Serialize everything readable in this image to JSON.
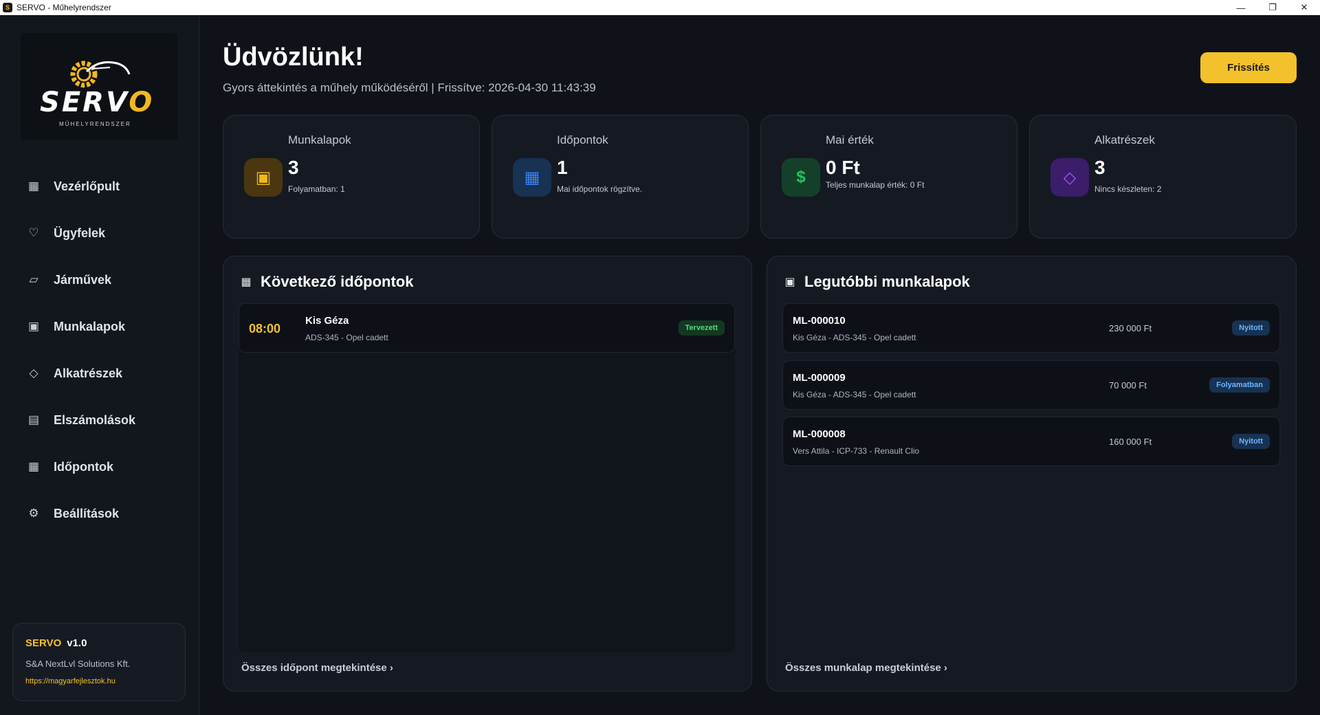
{
  "window": {
    "title": "SERVO - Műhelyrendszer",
    "controls": [
      "minimize-icon",
      "restore-icon",
      "close-icon"
    ]
  },
  "sidebar": {
    "logo": {
      "text": "SERVO",
      "subtitle": "MŰHELYRENDSZER"
    },
    "items": [
      {
        "label": "Vezérlőpult",
        "icon": "grid-icon"
      },
      {
        "label": "Ügyfelek",
        "icon": "heart-icon"
      },
      {
        "label": "Járművek",
        "icon": "car-icon"
      },
      {
        "label": "Munkalapok",
        "icon": "worksheet-icon"
      },
      {
        "label": "Alkatrészek",
        "icon": "diamond-icon"
      },
      {
        "label": "Elszámolások",
        "icon": "ledger-icon"
      },
      {
        "label": "Időpontok",
        "icon": "calendar-icon"
      },
      {
        "label": "Beállítások",
        "icon": "gear-icon"
      }
    ],
    "version": {
      "name": "SERVO",
      "number": "v1.0",
      "company": "S&A NextLvl Solutions Kft.",
      "url": "https://magyarfejlesztok.hu"
    }
  },
  "header": {
    "title": "Üdvözlünk!",
    "subtitle": "Gyors áttekintés a műhely működéséről | Frissítve: 2026-04-30 11:43:39",
    "refresh_label": "Frissítés"
  },
  "stats": [
    {
      "title": "Munkalapok",
      "value": "3",
      "desc": "Folyamatban: 1",
      "icon": "worksheet-icon",
      "color": "#f2b81f"
    },
    {
      "title": "Időpontok",
      "value": "1",
      "desc": "Mai időpontok rögzítve.",
      "icon": "calendar-icon",
      "color": "#3b82f6"
    },
    {
      "title": "Mai érték",
      "value": "0 Ft",
      "desc": "Teljes munkalap érték: 0 Ft",
      "icon": "dollar-icon",
      "color": "#22c55e"
    },
    {
      "title": "Alkatrészek",
      "value": "3",
      "desc": "Nincs készleten: 2",
      "icon": "diamond-icon",
      "color": "#a855f7"
    }
  ],
  "appointments": {
    "title": "Következő időpontok",
    "footer": "Összes időpont megtekintése  ›",
    "items": [
      {
        "time": "08:00",
        "name": "Kis Géza",
        "detail": "ADS-345 - Opel cadett",
        "status": "Tervezett"
      }
    ]
  },
  "worksheets": {
    "title": "Legutóbbi munkalapok",
    "footer": "Összes munkalap megtekintése  ›",
    "items": [
      {
        "id": "ML-000010",
        "detail": "Kis Géza  -  ADS-345 - Opel cadett",
        "amount": "230 000 Ft",
        "status": "Nyitott"
      },
      {
        "id": "ML-000009",
        "detail": "Kis Géza  -  ADS-345 - Opel cadett",
        "amount": "70 000 Ft",
        "status": "Folyamatban"
      },
      {
        "id": "ML-000008",
        "detail": "Vers Attila  -  ICP-733 - Renault Clio",
        "amount": "160 000 Ft",
        "status": "Nyitott"
      }
    ]
  }
}
